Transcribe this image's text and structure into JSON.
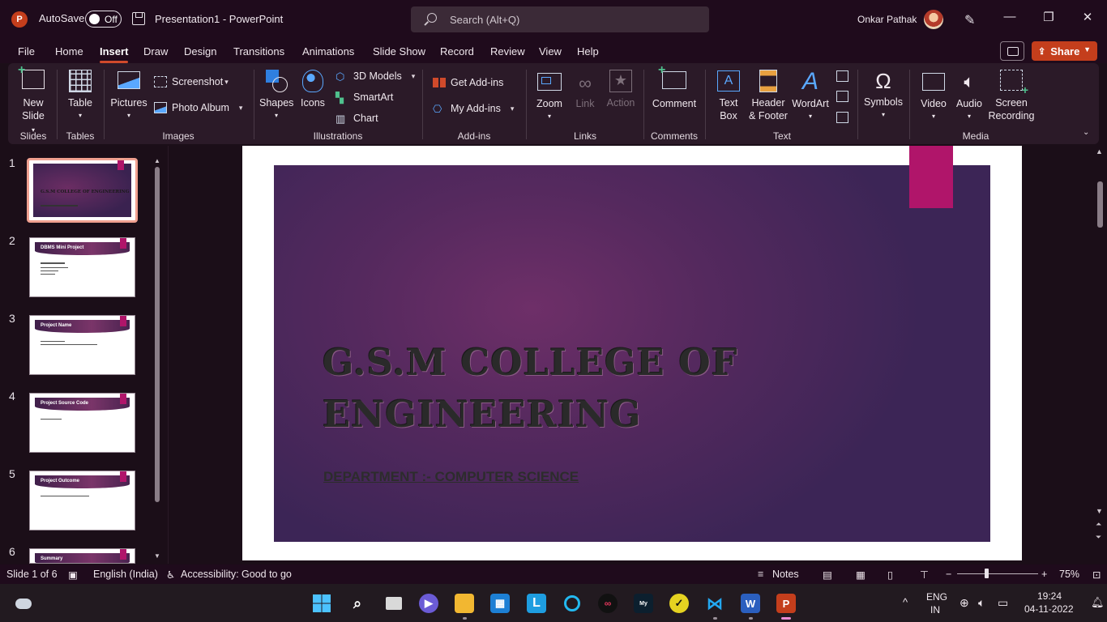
{
  "titlebar": {
    "app_logo": "P",
    "autosave_label": "AutoSave",
    "autosave_state": "Off",
    "doc_title": "Presentation1  -  PowerPoint",
    "search_placeholder": "Search (Alt+Q)",
    "user_name": "Onkar Pathak",
    "minimize": "—",
    "restore": "❐",
    "close": "✕"
  },
  "menu": {
    "tabs": [
      "File",
      "Home",
      "Insert",
      "Draw",
      "Design",
      "Transitions",
      "Animations",
      "Slide Show",
      "Record",
      "Review",
      "View",
      "Help"
    ],
    "active_tab": "Insert",
    "share_label": "Share"
  },
  "ribbon": {
    "new_slide": [
      "New",
      "Slide"
    ],
    "table": "Table",
    "pictures": "Pictures",
    "screenshot": "Screenshot",
    "photo_album": "Photo Album",
    "shapes": "Shapes",
    "icons": "Icons",
    "models_3d": "3D Models",
    "smartart": "SmartArt",
    "chart": "Chart",
    "get_addins": "Get Add-ins",
    "my_addins": "My Add-ins",
    "zoom": "Zoom",
    "link": "Link",
    "action": "Action",
    "comment": "Comment",
    "text_box": [
      "Text",
      "Box"
    ],
    "header_footer": [
      "Header",
      "& Footer"
    ],
    "wordart": "WordArt",
    "symbols": "Symbols",
    "video": "Video",
    "audio": "Audio",
    "screen_recording": [
      "Screen",
      "Recording"
    ],
    "groups": [
      "Slides",
      "Tables",
      "Images",
      "Illustrations",
      "Add-ins",
      "Links",
      "Comments",
      "Text",
      "Media"
    ]
  },
  "thumbnails": [
    {
      "num": "1",
      "title": "G.S.M COLLEGE OF ENGINEERING"
    },
    {
      "num": "2",
      "title": "DBMS Mini Project"
    },
    {
      "num": "3",
      "title": "Project Name"
    },
    {
      "num": "4",
      "title": "Project Source Code"
    },
    {
      "num": "5",
      "title": "Project Outcome"
    },
    {
      "num": "6",
      "title": "Summary"
    }
  ],
  "slide": {
    "title_line1": "G.S.M COLLEGE OF",
    "title_line2": "ENGINEERING",
    "subtitle": "DEPARTMENT :- COMPUTER SCIENCE"
  },
  "statusbar": {
    "slide_info": "Slide 1 of 6",
    "language": "English (India)",
    "accessibility": "Accessibility: Good to go",
    "notes": "Notes",
    "zoom_pct": "75%"
  },
  "taskbar": {
    "lang_line1": "ENG",
    "lang_line2": "IN",
    "time": "19:24",
    "date": "04-11-2022"
  }
}
